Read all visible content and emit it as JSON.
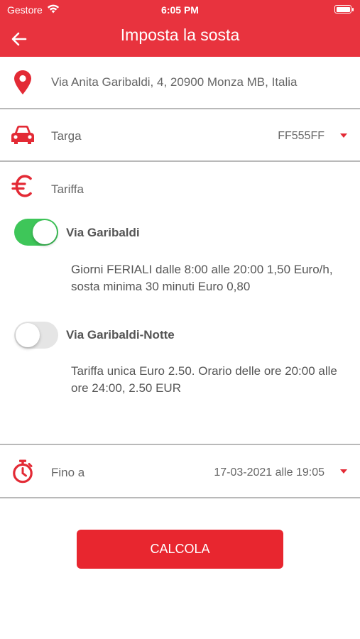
{
  "status_bar": {
    "carrier": "Gestore",
    "time": "6:05 PM"
  },
  "header": {
    "title": "Imposta la sosta",
    "back_icon": "back-arrow-icon"
  },
  "location": {
    "icon": "location-pin-icon",
    "address": "Via Anita Garibaldi, 4, 20900 Monza MB, Italia"
  },
  "plate": {
    "icon": "car-icon",
    "label": "Targa",
    "value": "FF555FF"
  },
  "tariff": {
    "icon": "euro-icon",
    "label": "Tariffa",
    "options": [
      {
        "name": "Via Garibaldi",
        "enabled": true,
        "description": "Giorni FERIALI dalle 8:00 alle 20:00 1,50 Euro/h, sosta minima 30 minuti Euro 0,80"
      },
      {
        "name": "Via Garibaldi-Notte",
        "enabled": false,
        "description": "Tariffa unica Euro 2.50. Orario delle ore 20:00 alle ore 24:00, 2.50 EUR"
      }
    ]
  },
  "until": {
    "icon": "stopwatch-icon",
    "label": "Fino a",
    "value": "17-03-2021 alle 19:05"
  },
  "action": {
    "calculate_label": "CALCOLA"
  },
  "colors": {
    "brand_red": "#e8333e",
    "toggle_on": "#3ec659",
    "toggle_off": "#e5e5e5"
  }
}
